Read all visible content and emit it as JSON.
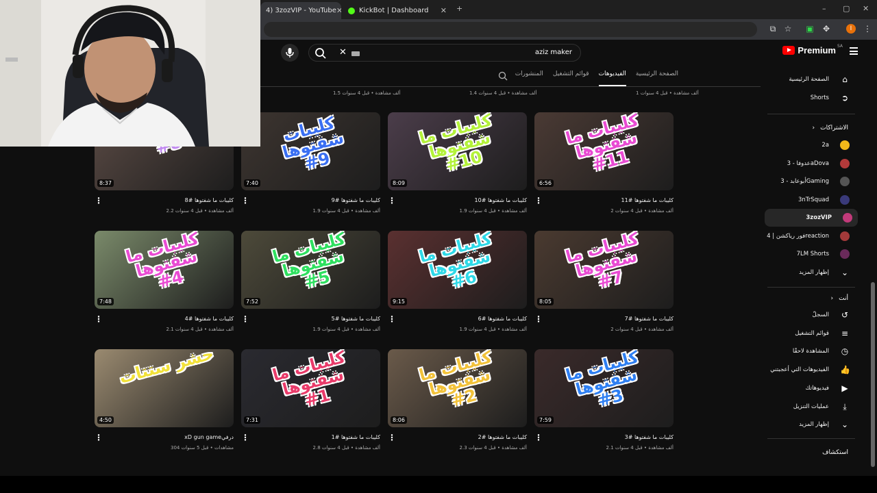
{
  "browser": {
    "tabs": [
      {
        "label": "4) 3zozVIP - YouTube",
        "close": "✕"
      },
      {
        "label": "KickBot | Dashboard",
        "close": "✕"
      }
    ],
    "new_tab": "+",
    "window_controls": {
      "minimize": "–",
      "maximize": "▢",
      "close": "✕"
    },
    "profile_letter": "I",
    "menu": "⋮"
  },
  "youtube": {
    "logo_text": "Premium",
    "region": "SA",
    "search_value": "aziz maker",
    "clear": "✕"
  },
  "channel_tabs": [
    {
      "label": "الصفحة الرئيسية",
      "selected": false
    },
    {
      "label": "الفيديوهات",
      "selected": true
    },
    {
      "label": "قوائم التشغيل",
      "selected": false
    },
    {
      "label": "المنشورات",
      "selected": false
    }
  ],
  "top_row_meta": [
    "1 ألف مشاهدة • قبل 4 سنوات",
    "1.4 ألف مشاهدة • قبل 4 سنوات",
    "1.5 ألف مشاهدة • قبل 4 سنوات"
  ],
  "videos": [
    {
      "title": "كليبات ما شفتوها #11",
      "meta": "2 ألف مشاهدة • قبل 4 سنوات",
      "duration": "6:56",
      "caption": "كليبات ما\nشفتوها\n#11",
      "cap_color": "#e94bd3",
      "bg": "#4a3a34"
    },
    {
      "title": "كليبات ما شفتوها #10",
      "meta": "1.9 ألف مشاهدة • قبل 4 سنوات",
      "duration": "8:09",
      "caption": "كليبات ما\nشفتوها\n#10",
      "cap_color": "#b4f23a",
      "bg": "#4b3d4a"
    },
    {
      "title": "كليبات ما شفتوها #9",
      "meta": "1.9 ألف مشاهدة • قبل 4 سنوات",
      "duration": "7:40",
      "caption": "كليبات\nشفتوها\n#9",
      "cap_color": "#3a6ff2",
      "bg": "#3d3530"
    },
    {
      "title": "كليبات ما شفتوها #8",
      "meta": "2.2 ألف مشاهدة • قبل 4 سنوات",
      "duration": "8:37",
      "caption": "شفتوها\n#8",
      "cap_color": "#c18af0",
      "bg": "#5a4a44"
    },
    {
      "title": "كليبات ما شفتوها #7",
      "meta": "2 ألف مشاهدة • قبل 4 سنوات",
      "duration": "8:05",
      "caption": "كليبات ما\nشفتوها\n#7",
      "cap_color": "#e94bd3",
      "bg": "#4a3a30"
    },
    {
      "title": "كليبات ما شفتوها #6",
      "meta": "1.9 ألف مشاهدة • قبل 4 سنوات",
      "duration": "9:15",
      "caption": "كليبات ما\nشفتوها\n#6",
      "cap_color": "#2fd9e8",
      "bg": "#5a3030"
    },
    {
      "title": "كليبات ما شفتوها #5",
      "meta": "1.9 ألف مشاهدة • قبل 4 سنوات",
      "duration": "7:52",
      "caption": "كليبات ما\nشفتوها\n#5",
      "cap_color": "#2fe060",
      "bg": "#4d4a3a"
    },
    {
      "title": "كليبات ما شفتوها #4",
      "meta": "2.1 ألف مشاهدة • قبل 4 سنوات",
      "duration": "7:48",
      "caption": "كليبات ما\nشفتوها\n#4",
      "cap_color": "#e94bd3",
      "bg": "#7a8a6a"
    },
    {
      "title": "كليبات ما شفتوها #3",
      "meta": "2.1 ألف مشاهدة • قبل 4 سنوات",
      "duration": "7:59",
      "caption": "كليبات ما\nشفتوها\n#3",
      "cap_color": "#2f7ff2",
      "bg": "#3a2a2a"
    },
    {
      "title": "كليبات ما شفتوها #2",
      "meta": "2.3 ألف مشاهدة • قبل 4 سنوات",
      "duration": "8:06",
      "caption": "كليبات ما\nشفتوها\n#2",
      "cap_color": "#f2c23a",
      "bg": "#6a5a4a"
    },
    {
      "title": "كليبات ما شفتوها #1",
      "meta": "2.8 ألف مشاهدة • قبل 4 سنوات",
      "duration": "7:31",
      "caption": "كليبات ما\nشفتوها\n#1",
      "cap_color": "#e93b6a",
      "bg": "#2a2a30"
    },
    {
      "title": "xD gun gameدرفي",
      "meta": "304 مشاهدات • قبل 5 سنوات",
      "duration": "4:50",
      "caption": "حشر ستتات",
      "cap_color": "#f2e23a",
      "bg": "#9a8a70"
    }
  ],
  "sidebar": {
    "main": [
      {
        "label": "الصفحة الرئيسية",
        "icon": "⌂"
      },
      {
        "label": "Shorts",
        "icon": "➲"
      }
    ],
    "subs_header": "الاشتراكات",
    "subs_chevron": "›",
    "subs": [
      {
        "label": "2a",
        "color": "#f2b81a",
        "selected": false
      },
      {
        "label": "عدوفا - 3aDova",
        "color": "#b33a3a",
        "selected": false
      },
      {
        "label": "أبوعابد - 3Gaming",
        "color": "#555555",
        "selected": false
      },
      {
        "label": "3nTrSquad",
        "color": "#3a3a7a",
        "selected": false
      },
      {
        "label": "3zozVIP",
        "color": "#c23a7a",
        "selected": true
      },
      {
        "label": "فور رياكشن | 4reaction",
        "color": "#a33a3a",
        "selected": false
      },
      {
        "label": "7LM Shorts",
        "color": "#6a2a5a",
        "selected": false
      },
      {
        "label": "إظهار المزيد",
        "color": "",
        "selected": false
      }
    ],
    "you_header": "أنت",
    "you": [
      {
        "label": "السجلّ",
        "icon": "↺"
      },
      {
        "label": "قوائم التشغيل",
        "icon": "≡"
      },
      {
        "label": "المشاهدة لاحقًا",
        "icon": "◷"
      },
      {
        "label": "الفيديوهات التي أعجبتني",
        "icon": "👍"
      },
      {
        "label": "فيديوهاتك",
        "icon": "▶"
      },
      {
        "label": "عمليات التنزيل",
        "icon": "⤓"
      },
      {
        "label": "إظهار المزيد",
        "icon": "⌄"
      }
    ],
    "explore_header": "استكشاف"
  }
}
